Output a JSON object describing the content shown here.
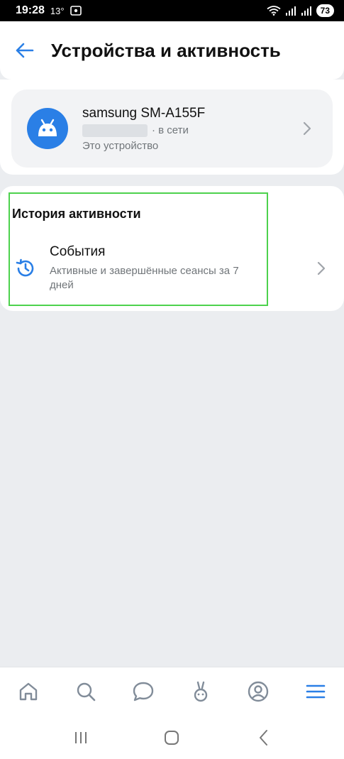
{
  "status_bar": {
    "time": "19:28",
    "temperature": "13°",
    "battery": "73"
  },
  "header": {
    "title": "Устройства и активность"
  },
  "device": {
    "name": "samsung SM-A155F",
    "status": "· в сети",
    "subtitle": "Это устройство"
  },
  "activity": {
    "section_title": "История активности",
    "events": {
      "title": "События",
      "subtitle": "Активные и завершённые сеансы за 7 дней"
    }
  },
  "colors": {
    "accent": "#2a7fe6",
    "highlight": "#4dd24d",
    "background": "#ebedf0"
  },
  "icons": {
    "back": "arrow-left-icon",
    "device": "android-icon",
    "chevron": "chevron-right-icon",
    "history": "history-clock-icon",
    "nav": [
      "home-icon",
      "search-icon",
      "chat-icon",
      "clips-icon",
      "profile-icon",
      "menu-icon"
    ]
  }
}
